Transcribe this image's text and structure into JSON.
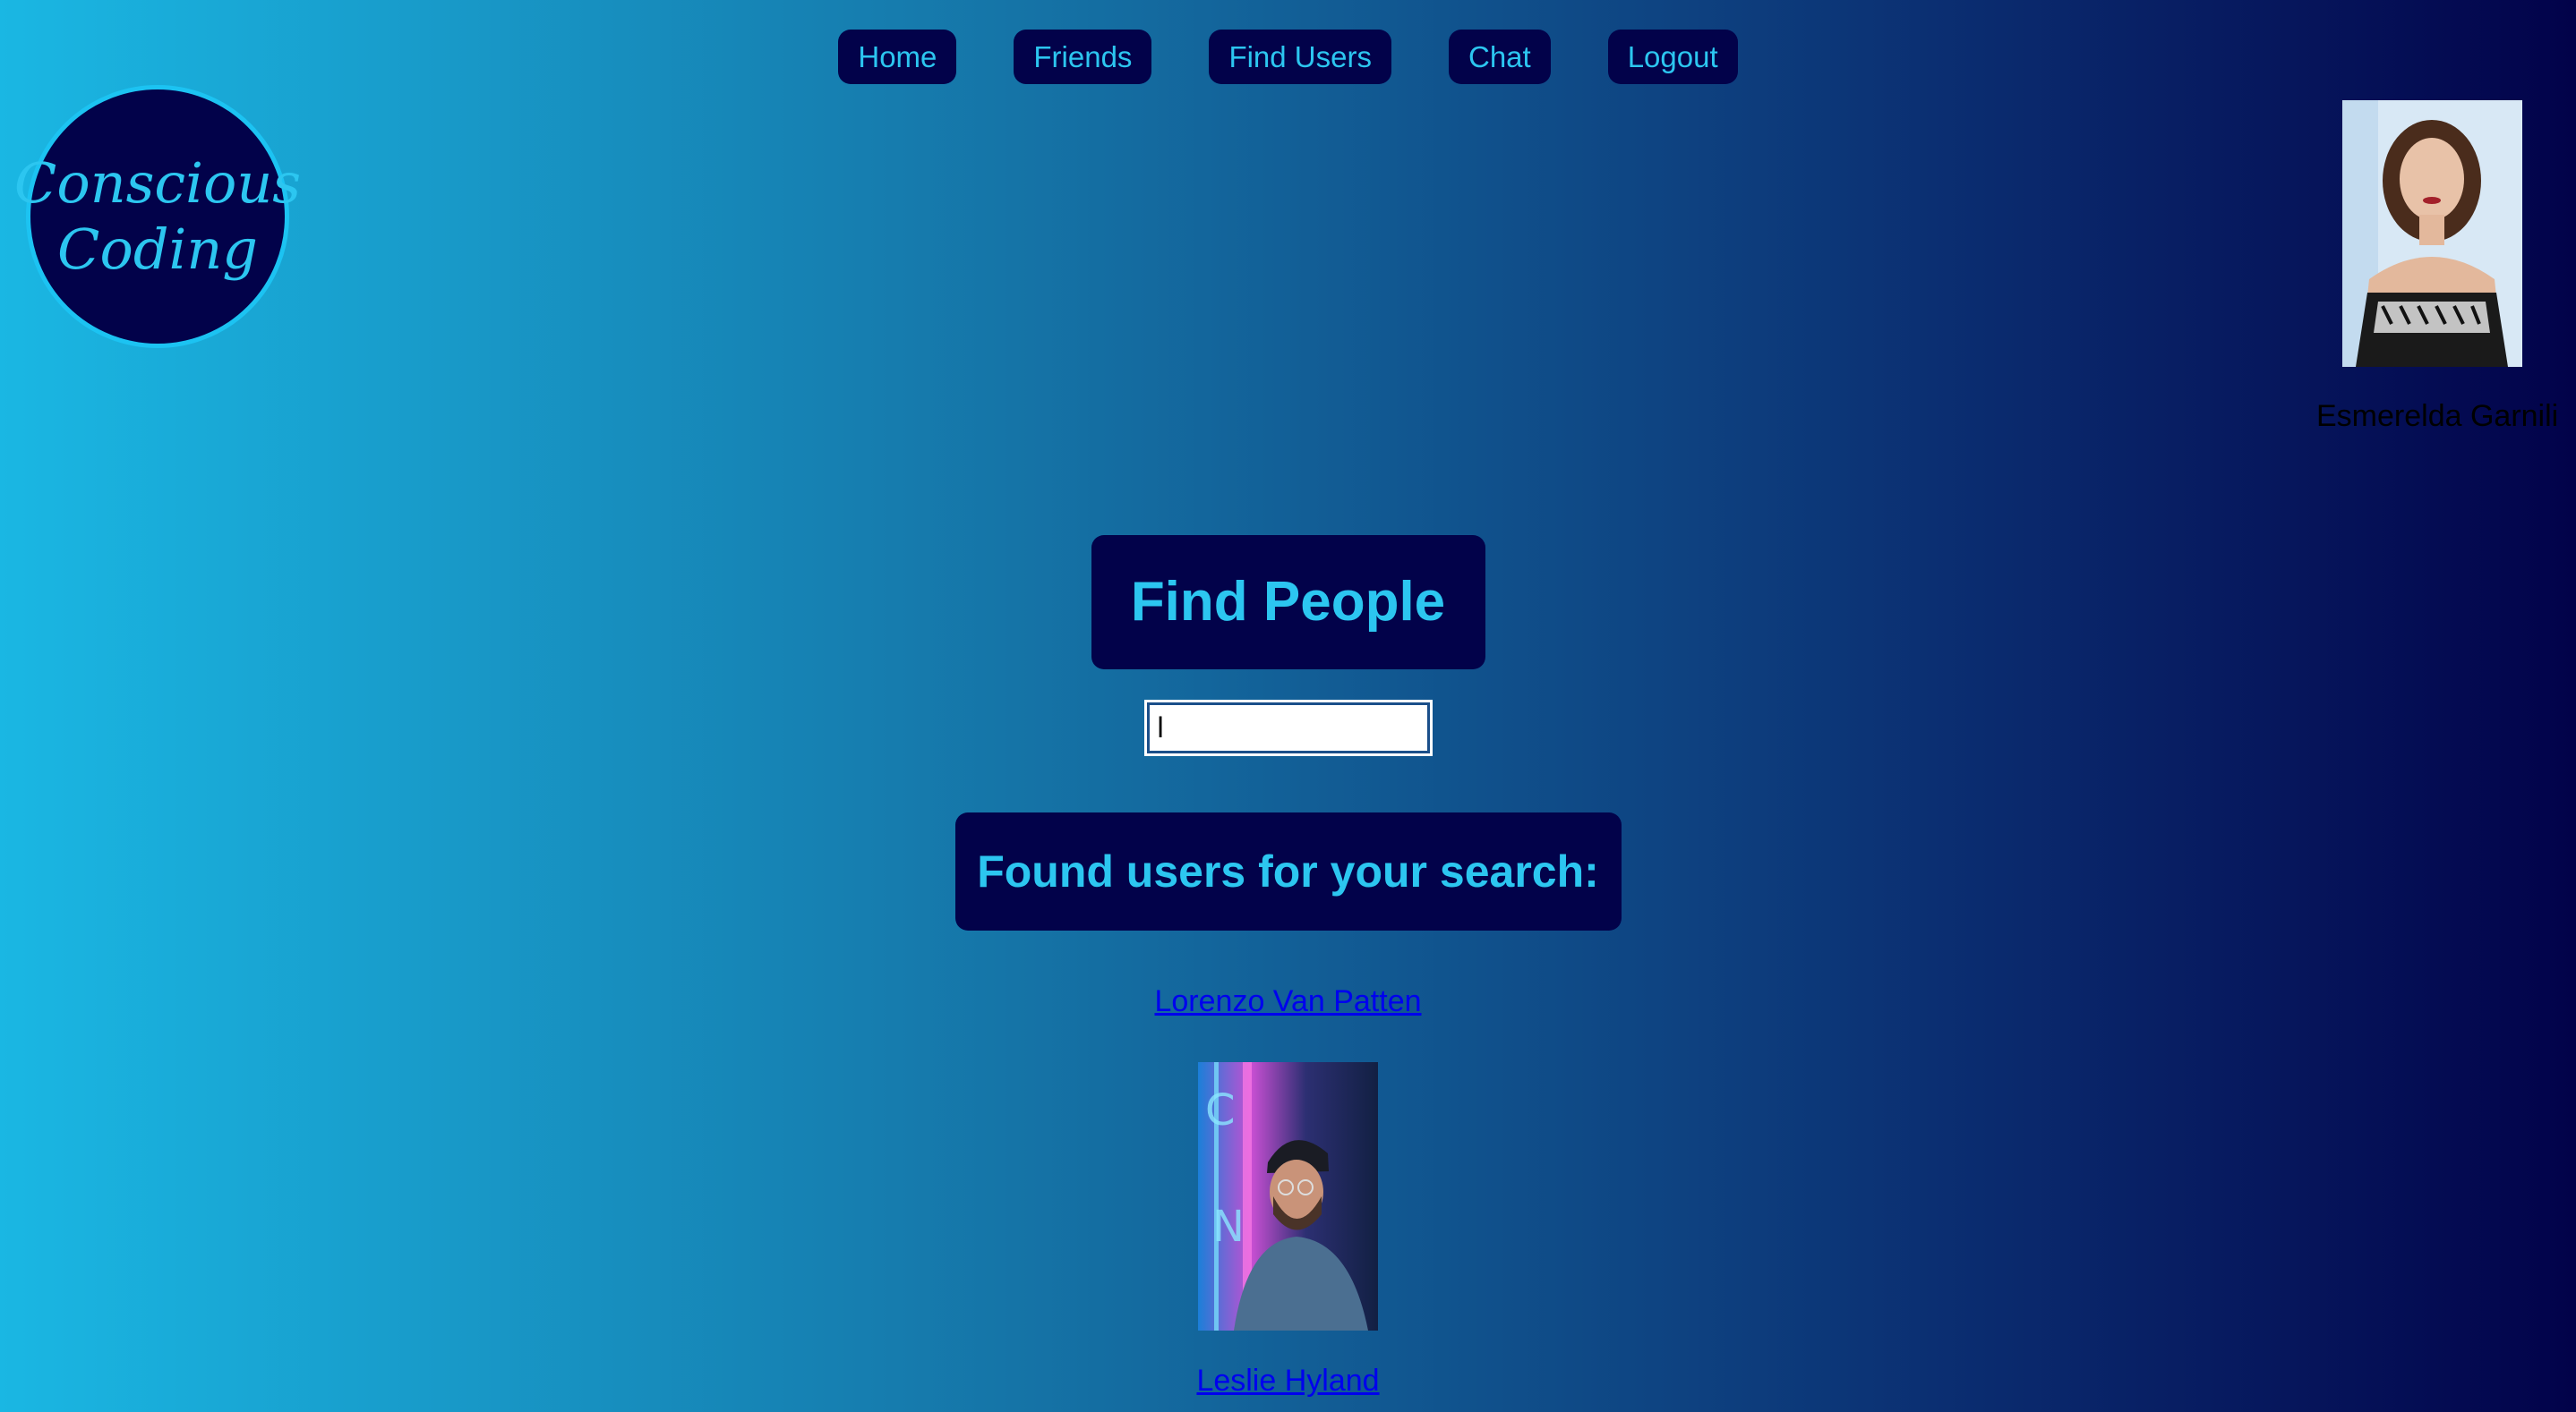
{
  "nav": {
    "items": [
      {
        "label": "Home"
      },
      {
        "label": "Friends"
      },
      {
        "label": "Find Users"
      },
      {
        "label": "Chat"
      },
      {
        "label": "Logout"
      }
    ]
  },
  "logo": {
    "line1": "Conscious",
    "line2": "Coding"
  },
  "profile": {
    "name": "Esmerelda Garnili",
    "avatar_icon": "profile-photo"
  },
  "main": {
    "title": "Find People",
    "search": {
      "value": "l",
      "placeholder": ""
    },
    "results_heading": "Found users for your search:",
    "results": [
      {
        "name": "Lorenzo Van Patten",
        "photo": "user-photo"
      },
      {
        "name": "Leslie Hyland",
        "photo": ""
      }
    ]
  },
  "colors": {
    "accent": "#2cc6f0",
    "panel": "#02024a",
    "link": "#0000ee"
  }
}
